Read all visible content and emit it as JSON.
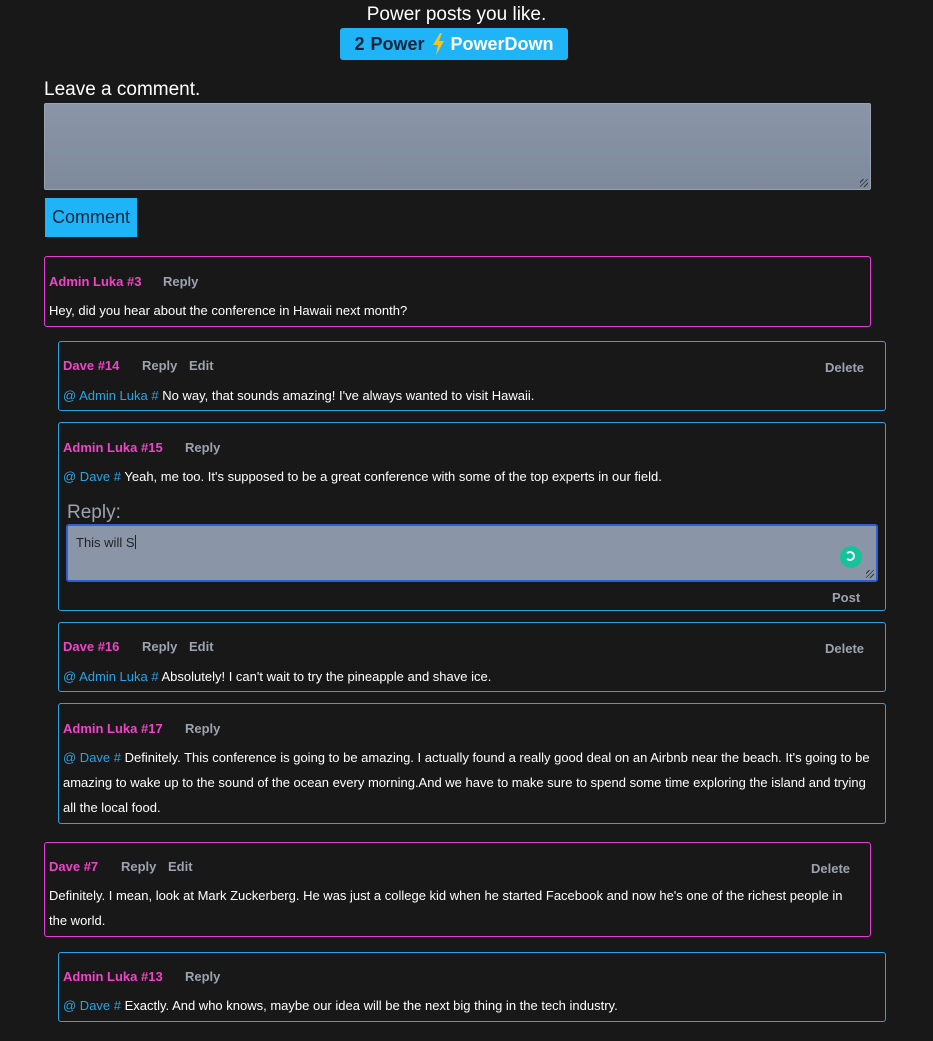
{
  "header": {
    "tagline": "Power posts you like.",
    "power_count": "2",
    "power_label": "Power",
    "powerdown_label": "PowerDown"
  },
  "composer": {
    "label": "Leave a comment.",
    "value": "",
    "button_label": "Comment"
  },
  "actions": {
    "reply": "Reply",
    "edit": "Edit",
    "delete": "Delete",
    "post": "Post"
  },
  "comments": [
    {
      "author": "Admin Luka #3",
      "mention": "",
      "text": "Hey, did you hear about the conference in Hawaii next month?"
    },
    {
      "author": "Dave #14",
      "mention": "@ Admin Luka #",
      "text": "No way, that sounds amazing! I've always wanted to visit Hawaii."
    },
    {
      "author": "Admin Luka #15",
      "mention": "@ Dave #",
      "text": "Yeah, me too. It's supposed to be a great conference with some of the top experts in our field."
    },
    {
      "author": "Dave #16",
      "mention": "@ Admin Luka #",
      "text": "Absolutely! I can't wait to try the pineapple and shave ice."
    },
    {
      "author": "Admin Luka #17",
      "mention": "@ Dave #",
      "text": "Definitely. This conference is going to be amazing. I actually found a really good deal on an Airbnb near the beach. It's going to be amazing to wake up to the sound of the ocean every morning.And we have to make sure to spend some time exploring the island and trying all the local food."
    },
    {
      "author": "Dave #7",
      "mention": "",
      "text": "Definitely. I mean, look at Mark Zuckerberg. He was just a college kid when he started Facebook and now he's one of the richest people in the world."
    },
    {
      "author": "Admin Luka #13",
      "mention": "@ Dave #",
      "text": "Exactly. And who knows, maybe our idea will be the next big thing in the tech industry."
    }
  ],
  "reply_box": {
    "label": "Reply:",
    "value": "This will S"
  },
  "colors": {
    "background": "#181818",
    "accent": "#1eb4f7",
    "author": "#f044c8",
    "mention": "#2aa3e6",
    "top_level_border": "#e040d0",
    "nested_border": "#2aa3e6",
    "grammar_icon": "#15c39a"
  },
  "icons": {
    "power": "lightning-bolt-icon",
    "grammar": "grammarly-icon"
  }
}
